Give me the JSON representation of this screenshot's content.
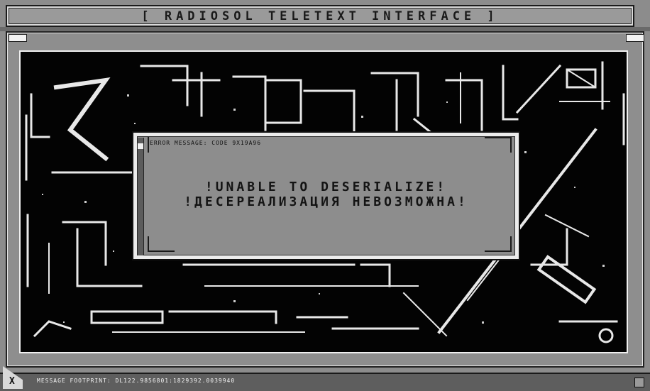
{
  "window": {
    "title": "[ RADIOSOL TELETEXT INTERFACE ]"
  },
  "dialog": {
    "header": "ERROR MESSAGE: CODE 9X19A96",
    "line1": "!UNABLE TO DESERIALIZE!",
    "line2": "!ДЕСЕРЕАЛИЗАЦИЯ НЕВОЗМОЖНА!"
  },
  "footer": {
    "close_label": "X",
    "footprint": "MESSAGE FOOTPRINT: DL122.9856801:1829392.0039940"
  },
  "icons": {
    "close": "close-icon",
    "resize": "resize-grip-icon"
  },
  "colors": {
    "background": "#8c8c8c",
    "viewport": "#030303",
    "ink": "#141414",
    "highlight": "#f0f0f0"
  }
}
